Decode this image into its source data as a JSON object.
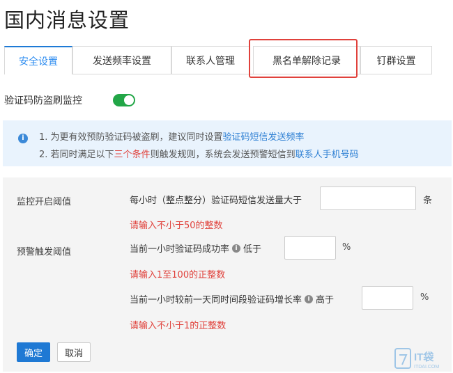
{
  "page": {
    "title": "国内消息设置"
  },
  "tabs": [
    {
      "label": "安全设置"
    },
    {
      "label": "发送频率设置"
    },
    {
      "label": "联系人管理"
    },
    {
      "label": "黑名单解除记录"
    },
    {
      "label": "钉群设置"
    }
  ],
  "toggle": {
    "label": "验证码防盗刷监控",
    "on": true,
    "color": "#22a647"
  },
  "info": {
    "line1_prefix": "1. 为更有效预防验证码被盗刷，建议同时设置",
    "line1_link": "验证码短信发送频率",
    "line2_prefix": "2. 若同时满足以下",
    "line2_red": "三个条件",
    "line2_mid": "则触发规则，系统会发送预警短信到",
    "line2_link": "联系人手机号码"
  },
  "settings": {
    "monitor_threshold_label": "监控开启阈值",
    "alert_threshold_label": "预警触发阈值",
    "rule1": {
      "text": "每小时（整点整分）验证码短信发送量大于",
      "value": "",
      "unit": "条",
      "error": "请输入不小于50的整数"
    },
    "rule2": {
      "text": "当前一小时验证码成功率",
      "info": "i",
      "comparator": "低于",
      "value": "",
      "unit": "%",
      "error": "请输入1至100的正整数"
    },
    "rule3": {
      "text": "当前一小时较前一天同时间段验证码增长率",
      "info": "i",
      "comparator": "高于",
      "value": "",
      "unit": "%",
      "error": "请输入不小于1的正整数"
    }
  },
  "actions": {
    "confirm": "确定",
    "cancel": "取消"
  },
  "watermark": {
    "text": "IT袋",
    "subtext": "ITDAI.COM"
  },
  "colors": {
    "accent": "#1f79d4",
    "error": "#e0413b",
    "highlight": "#e0413b"
  }
}
